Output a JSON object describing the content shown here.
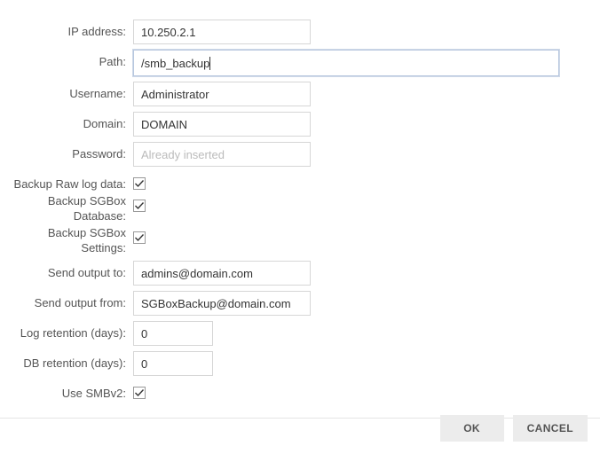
{
  "labels": {
    "ip": "IP address:",
    "path": "Path:",
    "username": "Username:",
    "domain": "Domain:",
    "password": "Password:",
    "raw": "Backup Raw log data:",
    "db1": "Backup SGBox",
    "db2": "Database:",
    "set1": "Backup SGBox",
    "set2": "Settings:",
    "sendTo": "Send output to:",
    "sendFrom": "Send output from:",
    "logRet": "Log retention (days):",
    "dbRet": "DB retention (days):",
    "smb": "Use SMBv2:"
  },
  "values": {
    "ip": "10.250.2.1",
    "path": "/smb_backup",
    "username": "Administrator",
    "domain": "DOMAIN",
    "passwordPlaceholder": "Already inserted",
    "sendTo": "admins@domain.com",
    "sendFrom": "SGBoxBackup@domain.com",
    "logRet": "0",
    "dbRet": "0"
  },
  "buttons": {
    "ok": "OK",
    "cancel": "CANCEL"
  }
}
